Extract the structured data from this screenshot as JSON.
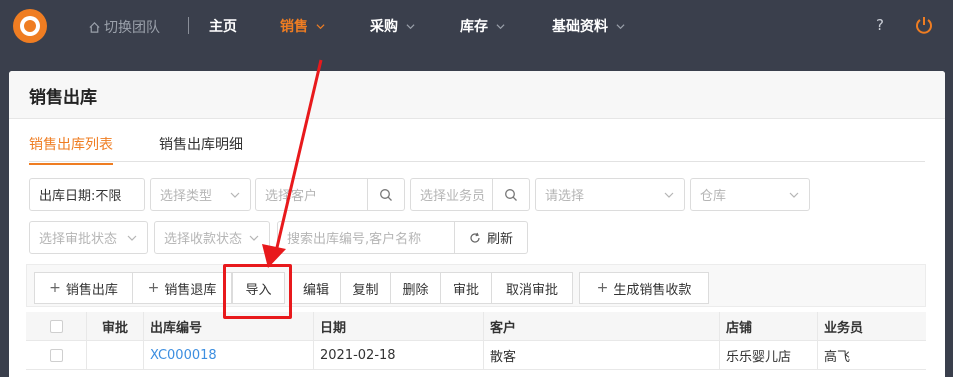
{
  "nav": {
    "switch_team": "切换团队",
    "items": [
      {
        "label": "主页",
        "has_menu": false
      },
      {
        "label": "销售",
        "has_menu": true,
        "active": true
      },
      {
        "label": "采购",
        "has_menu": true
      },
      {
        "label": "库存",
        "has_menu": true
      },
      {
        "label": "基础资料",
        "has_menu": true
      }
    ],
    "help": "?"
  },
  "page": {
    "title": "销售出库",
    "tabs": [
      {
        "label": "销售出库列表",
        "active": true
      },
      {
        "label": "销售出库明细",
        "active": false
      }
    ]
  },
  "filters": {
    "date": "出库日期:不限",
    "type_placeholder": "选择类型",
    "customer_placeholder": "选择客户",
    "salesperson_placeholder": "选择业务员",
    "generic_placeholder": "请选择",
    "warehouse_placeholder": "仓库",
    "approval_placeholder": "选择审批状态",
    "payment_placeholder": "选择收款状态",
    "search_placeholder": "搜索出库编号,客户名称",
    "refresh_label": "刷新"
  },
  "toolbar": {
    "sales_out": "销售出库",
    "sales_return": "销售退库",
    "import": "导入",
    "edit": "编辑",
    "copy": "复制",
    "delete": "删除",
    "approve": "审批",
    "cancel_approve": "取消审批",
    "generate_receipt": "生成销售收款"
  },
  "table": {
    "columns": [
      "审批",
      "出库编号",
      "日期",
      "客户",
      "店铺",
      "业务员"
    ],
    "rows": [
      {
        "approval": "",
        "code": "XC000018",
        "date": "2021-02-18",
        "customer": "散客",
        "shop": "乐乐婴儿店",
        "salesperson": "高飞"
      }
    ]
  },
  "colors": {
    "accent": "#ef7d22",
    "topbar": "#3a3f4c",
    "link": "#3c8ee0",
    "annotation": "#e8191c"
  }
}
